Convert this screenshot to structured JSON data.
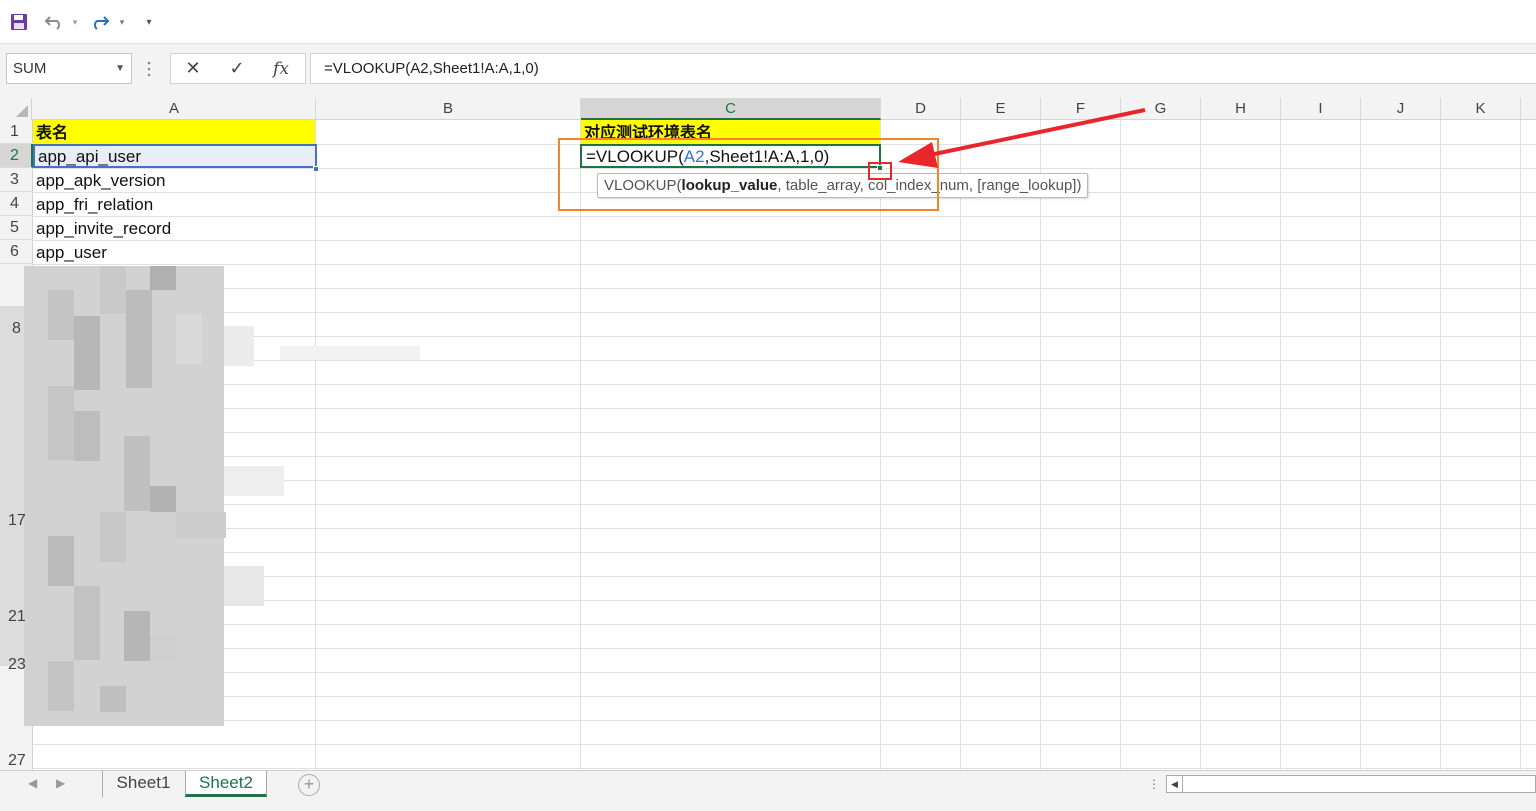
{
  "toolbar": {
    "save_icon": "save-icon",
    "undo_icon": "undo-icon",
    "redo_icon": "redo-icon",
    "customize_icon": "customize-icon"
  },
  "formula_bar": {
    "name_box": "SUM",
    "cancel_glyph": "✕",
    "enter_glyph": "✓",
    "fx_glyph": "fx",
    "formula": "=VLOOKUP(A2,Sheet1!A:A,1,0)"
  },
  "columns": [
    "A",
    "B",
    "C",
    "D",
    "E",
    "F",
    "G",
    "H",
    "I",
    "J",
    "K"
  ],
  "rows_visible": [
    "1",
    "2",
    "3",
    "4",
    "5",
    "6"
  ],
  "cells": {
    "A1": "表名",
    "A2": "app_api_user",
    "A3": "app_apk_version",
    "A4": "app_fri_relation",
    "A5": "app_invite_record",
    "A6": "app_user",
    "C1": "对应测试环境表名",
    "C2_prefix": "=VLOOKUP(",
    "C2_ref": "A2",
    "C2_suffix": ",Sheet1!A:A,1,0)"
  },
  "partial_row_labels": [
    "8",
    "17",
    "21",
    "23",
    "27"
  ],
  "tooltip": {
    "func": "VLOOKUP(",
    "arg1": "lookup_value",
    "rest": ", table_array, col_index_num, [range_lookup])"
  },
  "sheets": [
    "Sheet1",
    "Sheet2"
  ],
  "active_sheet": "Sheet2",
  "colors": {
    "accent": "#217346",
    "header_fill": "#ffff00",
    "annotation_orange": "#f0852a",
    "annotation_red": "#e8262b"
  }
}
